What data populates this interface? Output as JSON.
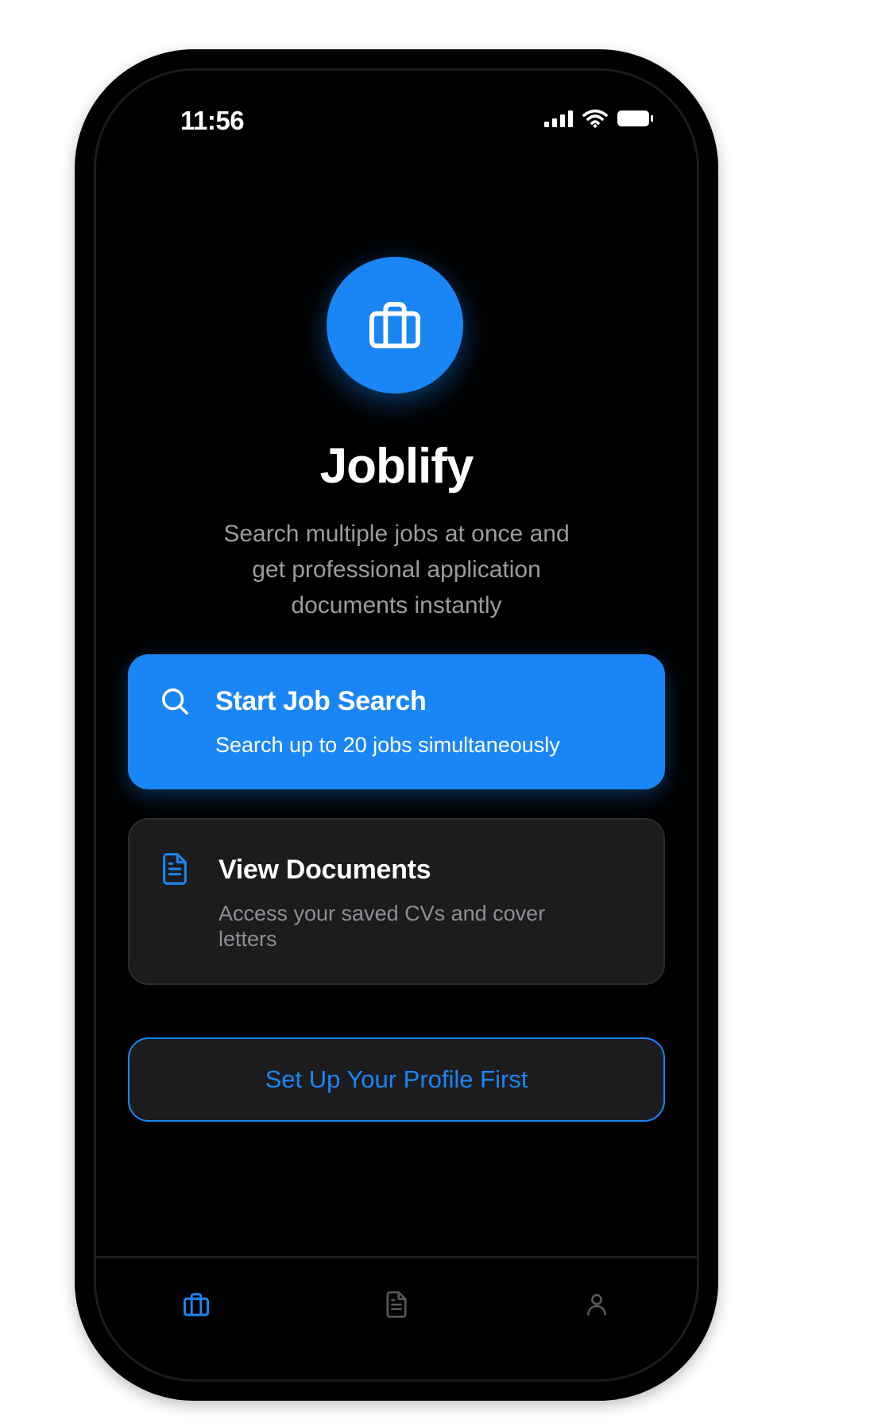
{
  "status_bar": {
    "time": "11:56",
    "icons": [
      "signal-icon",
      "wifi-icon",
      "battery-icon"
    ]
  },
  "app": {
    "logo_icon": "briefcase-icon",
    "title": "Joblify",
    "subtitle": "Search multiple jobs at once and get professional application documents instantly"
  },
  "actions": {
    "start_search": {
      "icon": "search-icon",
      "title": "Start Job Search",
      "description": "Search up to 20 jobs simultaneously"
    },
    "view_documents": {
      "icon": "document-icon",
      "title": "View Documents",
      "description": "Access your saved CVs and cover letters"
    },
    "profile_button": "Set Up Your Profile First"
  },
  "tab_bar": {
    "tabs": [
      {
        "icon": "briefcase-icon",
        "active": true
      },
      {
        "icon": "document-icon",
        "active": false
      },
      {
        "icon": "person-icon",
        "active": false
      }
    ]
  },
  "colors": {
    "accent": "#1a86f5",
    "background": "#000000",
    "card": "#1c1c1e",
    "muted_text": "#8e8e93"
  }
}
